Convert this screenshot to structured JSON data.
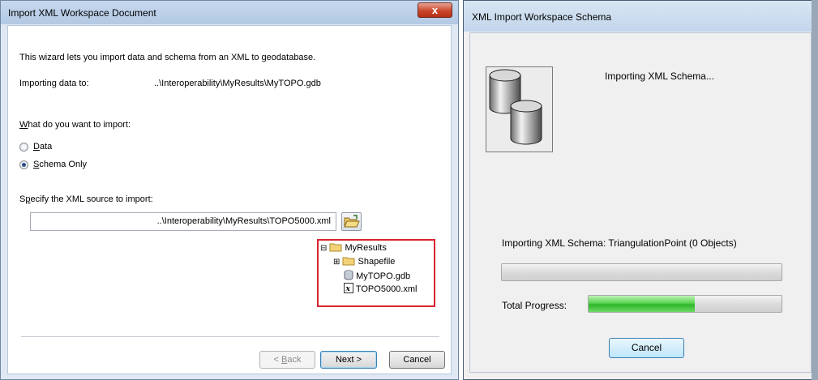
{
  "import_dialog": {
    "title": "Import XML Workspace Document",
    "close_glyph": "x",
    "intro": "This wizard lets you import data and schema from an XML to geodatabase.",
    "importing_to_label": "Importing data to:",
    "importing_to_path": "..\\Interoperability\\MyResults\\MyTOPO.gdb",
    "what_label_accel": "W",
    "what_label_rest": "hat do you want to import:",
    "options": [
      {
        "accel": "D",
        "rest": "ata",
        "selected": false
      },
      {
        "accel": "S",
        "rest": "chema Only",
        "selected": true
      }
    ],
    "source_label_pre": "S",
    "source_label_accel": "p",
    "source_label_rest": "ecify the XML source to import:",
    "source_value": "..\\Interoperability\\MyResults\\TOPO5000.xml",
    "tree": [
      {
        "label": "MyResults",
        "icon": "folder-icon",
        "expander": "⊟"
      },
      {
        "label": "Shapefile",
        "icon": "folder-icon",
        "expander": "⊞"
      },
      {
        "label": "MyTOPO.gdb",
        "icon": "geodatabase-icon",
        "expander": ""
      },
      {
        "label": "TOPO5000.xml",
        "icon": "xml-file-icon",
        "expander": ""
      }
    ],
    "buttons": {
      "back_pre": "< ",
      "back_accel": "B",
      "back_rest": "ack",
      "next": "Next >",
      "cancel": "Cancel"
    },
    "highlight_color": "#d6252f"
  },
  "schema_dialog": {
    "title": "XML Import Workspace Schema",
    "status": "Importing XML Schema...",
    "detail": "Importing XML Schema: TriangulationPoint (0 Objects)",
    "item_progress": 0,
    "total_label": "Total Progress:",
    "total_progress": 0.55,
    "cancel": "Cancel",
    "progress_color": "#3cc236"
  }
}
